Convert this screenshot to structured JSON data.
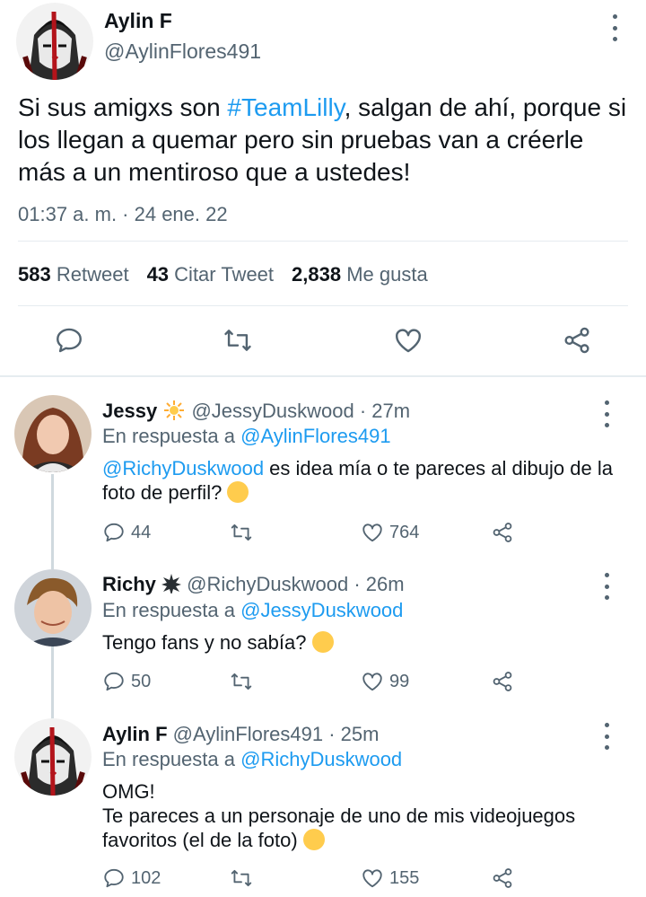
{
  "main": {
    "name": "Aylin F",
    "handle": "@AylinFlores491",
    "text_before": "Si sus amigxs son ",
    "hashtag": "#TeamLilly",
    "text_after": ", salgan de ahí, porque si los llegan a quemar pero sin pruebas van a créerle más a un mentiroso que a ustedes!",
    "timestamp": "01:37 a. m. · 24 ene. 22",
    "retweets_count": "583",
    "retweets_label": "Retweet",
    "quotes_count": "43",
    "quotes_label": "Citar Tweet",
    "likes_count": "2,838",
    "likes_label": "Me gusta"
  },
  "replies": [
    {
      "name": "Jessy",
      "handle": "@JessyDuskwood",
      "time": "27m",
      "reply_prefix": "En respuesta a",
      "reply_to": "@AylinFlores491",
      "mention": "@RichyDuskwood",
      "text": " es idea mía o te pareces al dibujo de la foto de perfil?",
      "replies": "44",
      "likes": "764"
    },
    {
      "name": "Richy",
      "handle": "@RichyDuskwood",
      "time": "26m",
      "reply_prefix": "En respuesta a",
      "reply_to": "@JessyDuskwood",
      "text": "Tengo fans y no sabía?",
      "replies": "50",
      "likes": "99"
    },
    {
      "name": "Aylin F",
      "handle": "@AylinFlores491",
      "time": "25m",
      "reply_prefix": "En respuesta a",
      "reply_to": "@RichyDuskwood",
      "text": "OMG!\nTe pareces a un personaje de uno de mis videojuegos favoritos (el de la foto)",
      "replies": "102",
      "likes": "155"
    }
  ],
  "colors": {
    "link": "#1d9bf0",
    "muted": "#536471",
    "text": "#0f1419",
    "divider": "#e6ecf0"
  },
  "icons": [
    "reply-icon",
    "retweet-icon",
    "like-icon",
    "share-icon",
    "more-options-icon",
    "sun-emoji",
    "burst-emoji",
    "flushed-face-emoji",
    "crying-face-emoji"
  ]
}
